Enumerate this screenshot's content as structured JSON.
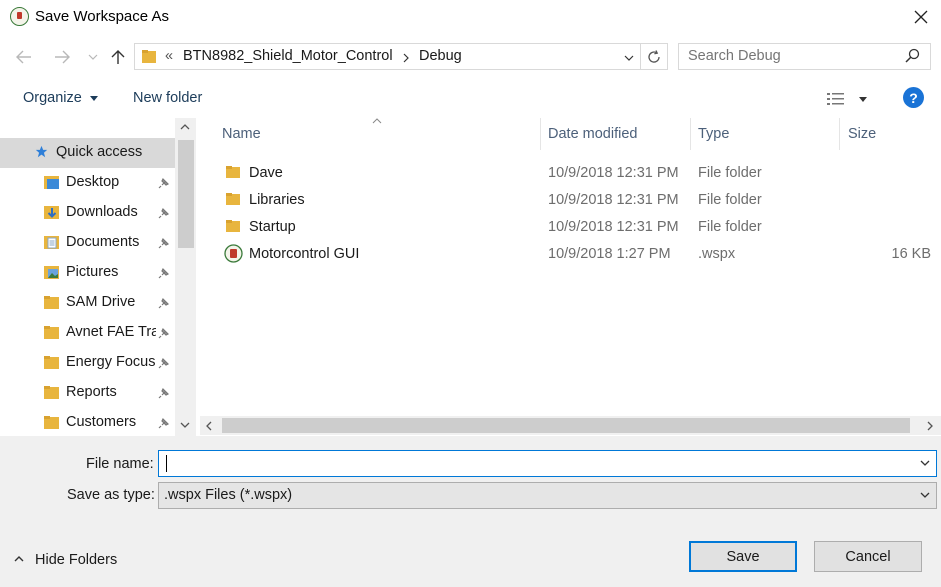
{
  "window": {
    "title": "Save Workspace As"
  },
  "address": {
    "overflow": "«",
    "segments": [
      "BTN8982_Shield_Motor_Control",
      "Debug"
    ]
  },
  "search": {
    "placeholder": "Search Debug"
  },
  "toolbar": {
    "organize": "Organize",
    "new_folder": "New folder",
    "help": "?"
  },
  "sidebar": {
    "quick_access": "Quick access",
    "items": [
      {
        "label": "Desktop",
        "icon": "desktop-icon"
      },
      {
        "label": "Downloads",
        "icon": "downloads-icon"
      },
      {
        "label": "Documents",
        "icon": "documents-icon"
      },
      {
        "label": "Pictures",
        "icon": "pictures-icon"
      },
      {
        "label": "SAM Drive",
        "icon": "folder-icon"
      },
      {
        "label": "Avnet FAE Tra",
        "icon": "folder-icon"
      },
      {
        "label": "Energy Focus",
        "icon": "folder-icon"
      },
      {
        "label": "Reports",
        "icon": "folder-icon"
      },
      {
        "label": "Customers",
        "icon": "folder-icon"
      }
    ]
  },
  "columns": {
    "name": "Name",
    "date": "Date modified",
    "type": "Type",
    "size": "Size"
  },
  "files": [
    {
      "name": "Dave",
      "date": "10/9/2018 12:31 PM",
      "type": "File folder",
      "size": ""
    },
    {
      "name": "Libraries",
      "date": "10/9/2018 12:31 PM",
      "type": "File folder",
      "size": ""
    },
    {
      "name": "Startup",
      "date": "10/9/2018 12:31 PM",
      "type": "File folder",
      "size": ""
    },
    {
      "name": "Motorcontrol GUI",
      "date": "10/9/2018 1:27 PM",
      "type": ".wspx",
      "size": "16 KB"
    }
  ],
  "form": {
    "file_name_label": "File name:",
    "file_name_value": "",
    "save_type_label": "Save as type:",
    "save_type_value": ".wspx Files (*.wspx)"
  },
  "footer": {
    "hide_folders": "Hide Folders",
    "save": "Save",
    "cancel": "Cancel"
  },
  "colors": {
    "accent": "#0078d7",
    "folder": "#e8b53e",
    "selected": "#d9d9d9"
  }
}
